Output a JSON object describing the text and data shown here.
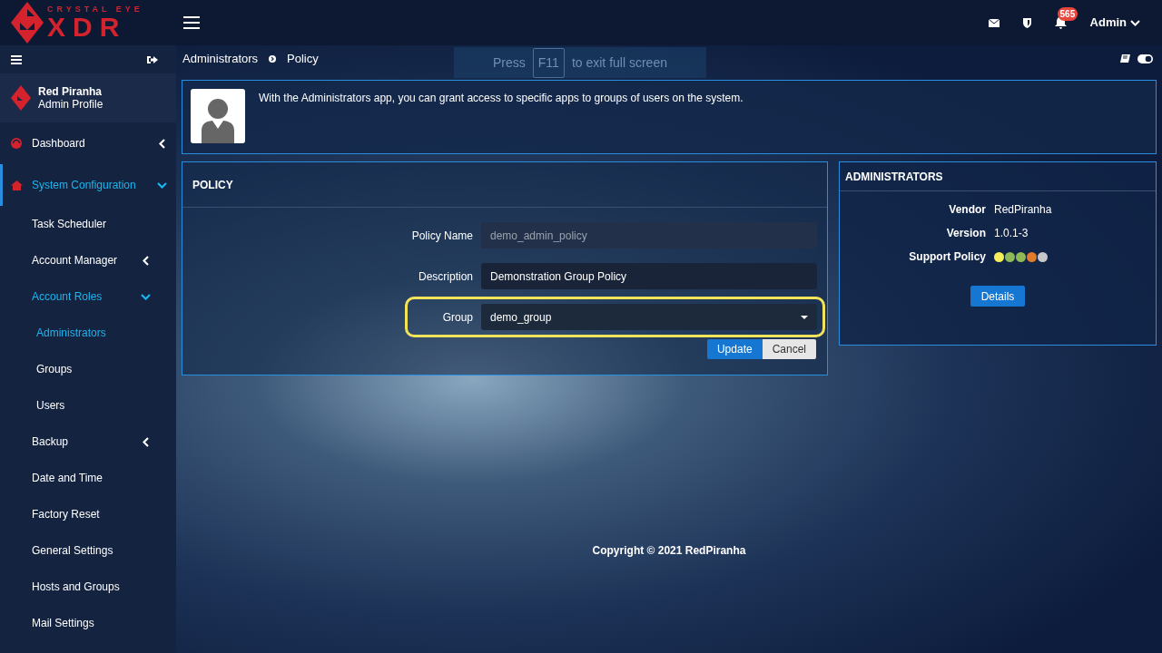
{
  "logo": {
    "tagline": "CRYSTAL EYE",
    "name": "XDR"
  },
  "topbar": {
    "notification_count": "565",
    "user": "Admin"
  },
  "sidebar": {
    "profile": {
      "name": "Red Piranha",
      "role": "Admin Profile"
    },
    "items": [
      {
        "label": "Dashboard",
        "kind": "dashboard",
        "selected": false,
        "expanded": false
      },
      {
        "label": "System Configuration",
        "kind": "config",
        "selected": true,
        "expanded": true,
        "children": [
          {
            "label": "Task Scheduler",
            "selected": false
          },
          {
            "label": "Account Manager",
            "selected": false,
            "expanded": false
          },
          {
            "label": "Account Roles",
            "selected": true,
            "expanded": true,
            "children": [
              {
                "label": "Administrators",
                "selected": true
              },
              {
                "label": "Groups",
                "selected": false
              },
              {
                "label": "Users",
                "selected": false
              }
            ]
          },
          {
            "label": "Backup",
            "selected": false,
            "expanded": false
          },
          {
            "label": "Date and Time",
            "selected": false
          },
          {
            "label": "Factory Reset",
            "selected": false
          },
          {
            "label": "General Settings",
            "selected": false
          },
          {
            "label": "Hosts and Groups",
            "selected": false
          },
          {
            "label": "Mail Settings",
            "selected": false
          }
        ]
      }
    ]
  },
  "breadcrumb": [
    "Administrators",
    "Policy"
  ],
  "fullscreen_notice": {
    "before": "Press",
    "key": "F11",
    "after": "to exit full screen"
  },
  "intro": "With the Administrators app, you can grant access to specific apps to groups of users on the system.",
  "policy": {
    "title": "POLICY",
    "fields": [
      {
        "label": "Policy Name",
        "kind": "readonly",
        "value": "demo_admin_policy",
        "highlighted": false
      },
      {
        "label": "Description",
        "kind": "text",
        "value": "Demonstration Group Policy",
        "highlighted": false
      },
      {
        "label": "Group",
        "kind": "select",
        "value": "demo_group",
        "highlighted": true
      }
    ],
    "buttons": [
      "Update",
      "Cancel"
    ]
  },
  "app_info": {
    "title": "ADMINISTRATORS",
    "rows": [
      {
        "label": "Vendor",
        "value": "RedPiranha"
      },
      {
        "label": "Version",
        "value": "1.0.1-3"
      }
    ],
    "support_label": "Support Policy",
    "support_dots": [
      {
        "color": "#f5f05a"
      },
      {
        "color": "#8fb856"
      },
      {
        "color": "#8fb856"
      },
      {
        "color": "#e07b2c"
      },
      {
        "color": "#c8c8c8"
      }
    ],
    "button": "Details"
  },
  "footer": "Copyright © 2021 RedPiranha"
}
